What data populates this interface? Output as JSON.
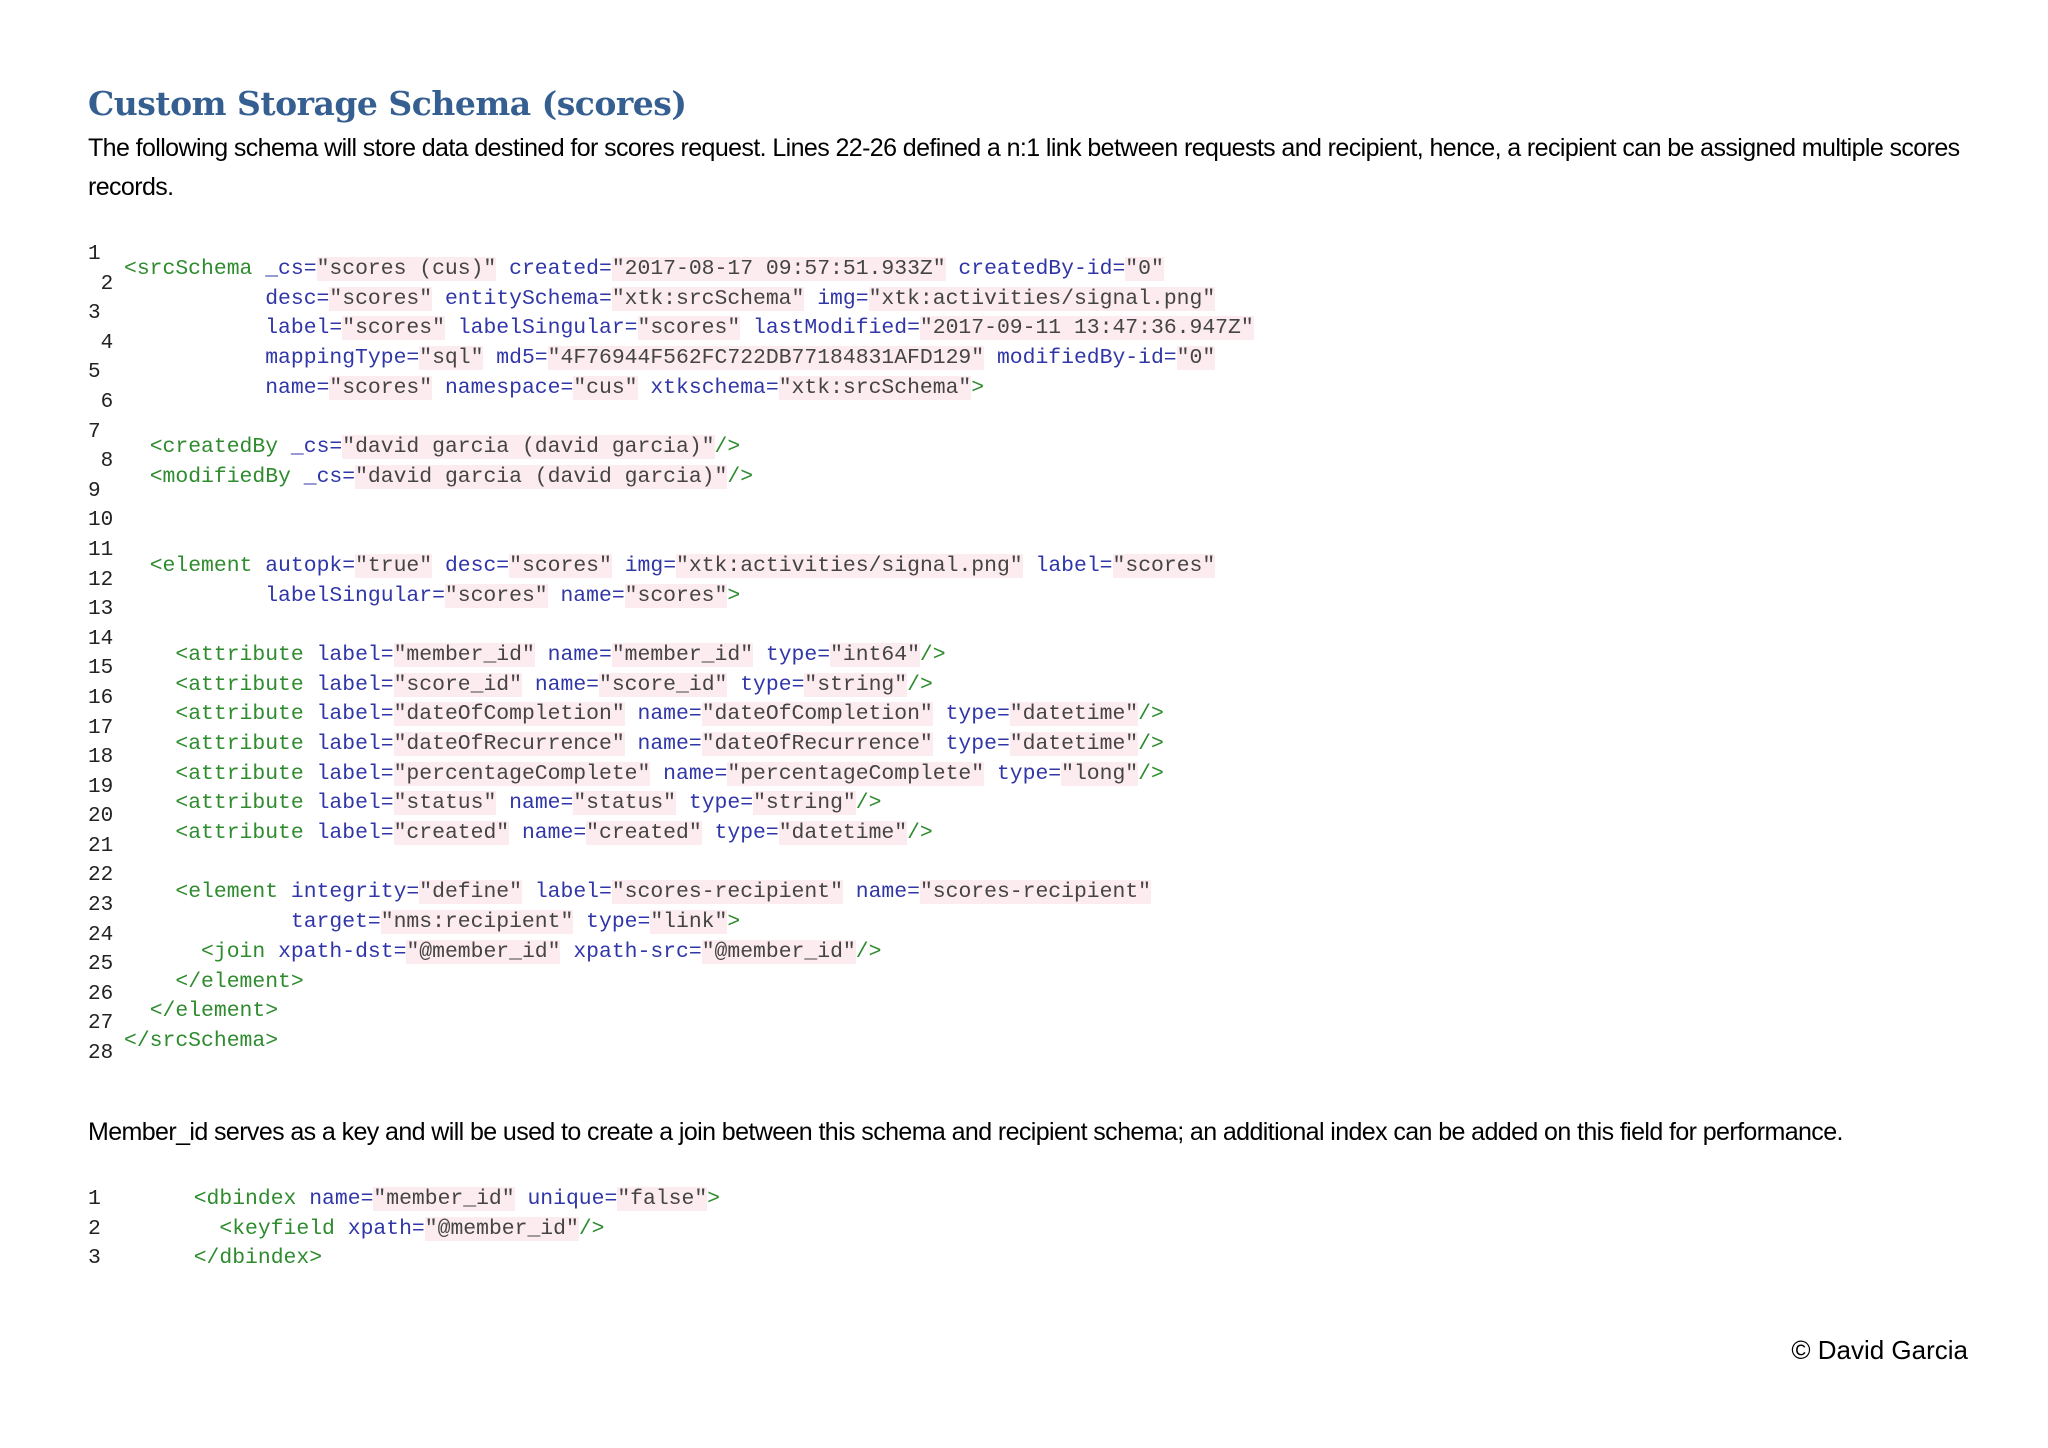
{
  "title": "Custom Storage Schema (scores)",
  "intro": "The following schema will store data destined for scores request. Lines 22-26 defined a n:1 link between requests and recipient, hence, a recipient can be assigned multiple scores records.",
  "main_code": {
    "line_numbers": [
      "1",
      "2",
      "3",
      "4",
      "5",
      "6",
      "7",
      "8",
      "9",
      "10",
      "11",
      "12",
      "13",
      "14",
      "15",
      "16",
      "17",
      "18",
      "19",
      "20",
      "21",
      "22",
      "23",
      "24",
      "25",
      "26",
      "27",
      "28"
    ],
    "lines": [
      [
        [
          "tag",
          "<srcSchema "
        ],
        [
          "attr",
          "_cs="
        ],
        [
          "val",
          "\"scores (cus)\""
        ],
        [
          "plain",
          " "
        ],
        [
          "attr",
          "created="
        ],
        [
          "val",
          "\"2017-08-17 09:57:51.933Z\""
        ],
        [
          "plain",
          " "
        ],
        [
          "attr",
          "createdBy-id="
        ],
        [
          "val",
          "\"0\""
        ]
      ],
      [
        [
          "plain",
          "           "
        ],
        [
          "attr",
          "desc="
        ],
        [
          "val",
          "\"scores\""
        ],
        [
          "plain",
          " "
        ],
        [
          "attr",
          "entitySchema="
        ],
        [
          "val",
          "\"xtk:srcSchema\""
        ],
        [
          "plain",
          " "
        ],
        [
          "attr",
          "img="
        ],
        [
          "val",
          "\"xtk:activities/signal.png\""
        ]
      ],
      [
        [
          "plain",
          "           "
        ],
        [
          "attr",
          "label="
        ],
        [
          "val",
          "\"scores\""
        ],
        [
          "plain",
          " "
        ],
        [
          "attr",
          "labelSingular="
        ],
        [
          "val",
          "\"scores\""
        ],
        [
          "plain",
          " "
        ],
        [
          "attr",
          "lastModified="
        ],
        [
          "val",
          "\"2017-09-11 13:47:36.947Z\""
        ]
      ],
      [
        [
          "plain",
          "           "
        ],
        [
          "attr",
          "mappingType="
        ],
        [
          "val",
          "\"sql\""
        ],
        [
          "plain",
          " "
        ],
        [
          "attr",
          "md5="
        ],
        [
          "val",
          "\"4F76944F562FC722DB77184831AFD129\""
        ],
        [
          "plain",
          " "
        ],
        [
          "attr",
          "modifiedBy-id="
        ],
        [
          "val",
          "\"0\""
        ]
      ],
      [
        [
          "plain",
          "           "
        ],
        [
          "attr",
          "name="
        ],
        [
          "val",
          "\"scores\""
        ],
        [
          "plain",
          " "
        ],
        [
          "attr",
          "namespace="
        ],
        [
          "val",
          "\"cus\""
        ],
        [
          "plain",
          " "
        ],
        [
          "attr",
          "xtkschema="
        ],
        [
          "val",
          "\"xtk:srcSchema\""
        ],
        [
          "tag",
          ">"
        ]
      ],
      [],
      [
        [
          "plain",
          "  "
        ],
        [
          "tag",
          "<createdBy "
        ],
        [
          "attr",
          "_cs="
        ],
        [
          "val",
          "\"david garcia (david garcia)\""
        ],
        [
          "tag",
          "/>"
        ]
      ],
      [
        [
          "plain",
          "  "
        ],
        [
          "tag",
          "<modifiedBy "
        ],
        [
          "attr",
          "_cs="
        ],
        [
          "val",
          "\"david garcia (david garcia)\""
        ],
        [
          "tag",
          "/>"
        ]
      ],
      [],
      [],
      [
        [
          "plain",
          "  "
        ],
        [
          "tag",
          "<element "
        ],
        [
          "attr",
          "autopk="
        ],
        [
          "val",
          "\"true\""
        ],
        [
          "plain",
          " "
        ],
        [
          "attr",
          "desc="
        ],
        [
          "val",
          "\"scores\""
        ],
        [
          "plain",
          " "
        ],
        [
          "attr",
          "img="
        ],
        [
          "val",
          "\"xtk:activities/signal.png\""
        ],
        [
          "plain",
          " "
        ],
        [
          "attr",
          "label="
        ],
        [
          "val",
          "\"scores\""
        ]
      ],
      [
        [
          "plain",
          "           "
        ],
        [
          "attr",
          "labelSingular="
        ],
        [
          "val",
          "\"scores\""
        ],
        [
          "plain",
          " "
        ],
        [
          "attr",
          "name="
        ],
        [
          "val",
          "\"scores\""
        ],
        [
          "tag",
          ">"
        ]
      ],
      [],
      [
        [
          "plain",
          "    "
        ],
        [
          "tag",
          "<attribute "
        ],
        [
          "attr",
          "label="
        ],
        [
          "val",
          "\"member_id\""
        ],
        [
          "plain",
          " "
        ],
        [
          "attr",
          "name="
        ],
        [
          "val",
          "\"member_id\""
        ],
        [
          "plain",
          " "
        ],
        [
          "attr",
          "type="
        ],
        [
          "val",
          "\"int64\""
        ],
        [
          "tag",
          "/>"
        ]
      ],
      [
        [
          "plain",
          "    "
        ],
        [
          "tag",
          "<attribute "
        ],
        [
          "attr",
          "label="
        ],
        [
          "val",
          "\"score_id\""
        ],
        [
          "plain",
          " "
        ],
        [
          "attr",
          "name="
        ],
        [
          "val",
          "\"score_id\""
        ],
        [
          "plain",
          " "
        ],
        [
          "attr",
          "type="
        ],
        [
          "val",
          "\"string\""
        ],
        [
          "tag",
          "/>"
        ]
      ],
      [
        [
          "plain",
          "    "
        ],
        [
          "tag",
          "<attribute "
        ],
        [
          "attr",
          "label="
        ],
        [
          "val",
          "\"dateOfCompletion\""
        ],
        [
          "plain",
          " "
        ],
        [
          "attr",
          "name="
        ],
        [
          "val",
          "\"dateOfCompletion\""
        ],
        [
          "plain",
          " "
        ],
        [
          "attr",
          "type="
        ],
        [
          "val",
          "\"datetime\""
        ],
        [
          "tag",
          "/>"
        ]
      ],
      [
        [
          "plain",
          "    "
        ],
        [
          "tag",
          "<attribute "
        ],
        [
          "attr",
          "label="
        ],
        [
          "val",
          "\"dateOfRecurrence\""
        ],
        [
          "plain",
          " "
        ],
        [
          "attr",
          "name="
        ],
        [
          "val",
          "\"dateOfRecurrence\""
        ],
        [
          "plain",
          " "
        ],
        [
          "attr",
          "type="
        ],
        [
          "val",
          "\"datetime\""
        ],
        [
          "tag",
          "/>"
        ]
      ],
      [
        [
          "plain",
          "    "
        ],
        [
          "tag",
          "<attribute "
        ],
        [
          "attr",
          "label="
        ],
        [
          "val",
          "\"percentageComplete\""
        ],
        [
          "plain",
          " "
        ],
        [
          "attr",
          "name="
        ],
        [
          "val",
          "\"percentageComplete\""
        ],
        [
          "plain",
          " "
        ],
        [
          "attr",
          "type="
        ],
        [
          "val",
          "\"long\""
        ],
        [
          "tag",
          "/>"
        ]
      ],
      [
        [
          "plain",
          "    "
        ],
        [
          "tag",
          "<attribute "
        ],
        [
          "attr",
          "label="
        ],
        [
          "val",
          "\"status\""
        ],
        [
          "plain",
          " "
        ],
        [
          "attr",
          "name="
        ],
        [
          "val",
          "\"status\""
        ],
        [
          "plain",
          " "
        ],
        [
          "attr",
          "type="
        ],
        [
          "val",
          "\"string\""
        ],
        [
          "tag",
          "/>"
        ]
      ],
      [
        [
          "plain",
          "    "
        ],
        [
          "tag",
          "<attribute "
        ],
        [
          "attr",
          "label="
        ],
        [
          "val",
          "\"created\""
        ],
        [
          "plain",
          " "
        ],
        [
          "attr",
          "name="
        ],
        [
          "val",
          "\"created\""
        ],
        [
          "plain",
          " "
        ],
        [
          "attr",
          "type="
        ],
        [
          "val",
          "\"datetime\""
        ],
        [
          "tag",
          "/>"
        ]
      ],
      [],
      [
        [
          "plain",
          "    "
        ],
        [
          "tag",
          "<element "
        ],
        [
          "attr",
          "integrity="
        ],
        [
          "val",
          "\"define\""
        ],
        [
          "plain",
          " "
        ],
        [
          "attr",
          "label="
        ],
        [
          "val",
          "\"scores-recipient\""
        ],
        [
          "plain",
          " "
        ],
        [
          "attr",
          "name="
        ],
        [
          "val",
          "\"scores-recipient\""
        ]
      ],
      [
        [
          "plain",
          "             "
        ],
        [
          "attr",
          "target="
        ],
        [
          "val",
          "\"nms:recipient\""
        ],
        [
          "plain",
          " "
        ],
        [
          "attr",
          "type="
        ],
        [
          "val",
          "\"link\""
        ],
        [
          "tag",
          ">"
        ]
      ],
      [
        [
          "plain",
          "      "
        ],
        [
          "tag",
          "<join "
        ],
        [
          "attr",
          "xpath-dst="
        ],
        [
          "val",
          "\"@member_id\""
        ],
        [
          "plain",
          " "
        ],
        [
          "attr",
          "xpath-src="
        ],
        [
          "val",
          "\"@member_id\""
        ],
        [
          "tag",
          "/>"
        ]
      ],
      [
        [
          "plain",
          "    "
        ],
        [
          "tag",
          "</element>"
        ]
      ],
      [
        [
          "plain",
          "  "
        ],
        [
          "tag",
          "</element>"
        ]
      ],
      [
        [
          "tag",
          "</srcSchema>"
        ]
      ]
    ]
  },
  "note": "Member_id serves as a key and will be used to create a join between this schema and recipient schema; an additional index can be added on this field for performance.",
  "index_code": {
    "rows": [
      {
        "num": "1",
        "tokens": [
          [
            "plain",
            "  "
          ],
          [
            "tag",
            "<dbindex "
          ],
          [
            "attr",
            "name="
          ],
          [
            "val",
            "\"member_id\""
          ],
          [
            "plain",
            " "
          ],
          [
            "attr",
            "unique="
          ],
          [
            "val",
            "\"false\""
          ],
          [
            "tag",
            ">"
          ]
        ]
      },
      {
        "num": "2",
        "tokens": [
          [
            "plain",
            "    "
          ],
          [
            "tag",
            "<keyfield "
          ],
          [
            "attr",
            "xpath="
          ],
          [
            "val",
            "\"@member_id\""
          ],
          [
            "tag",
            "/>"
          ]
        ]
      },
      {
        "num": "3",
        "tokens": [
          [
            "plain",
            "  "
          ],
          [
            "tag",
            "</dbindex>"
          ]
        ]
      }
    ]
  },
  "footer": "© David Garcia",
  "colors": {
    "title": "#365f91",
    "tag": "#2e8b2e",
    "attribute": "#3036a8",
    "value": "#444444",
    "value_highlight": "#fdecef"
  }
}
